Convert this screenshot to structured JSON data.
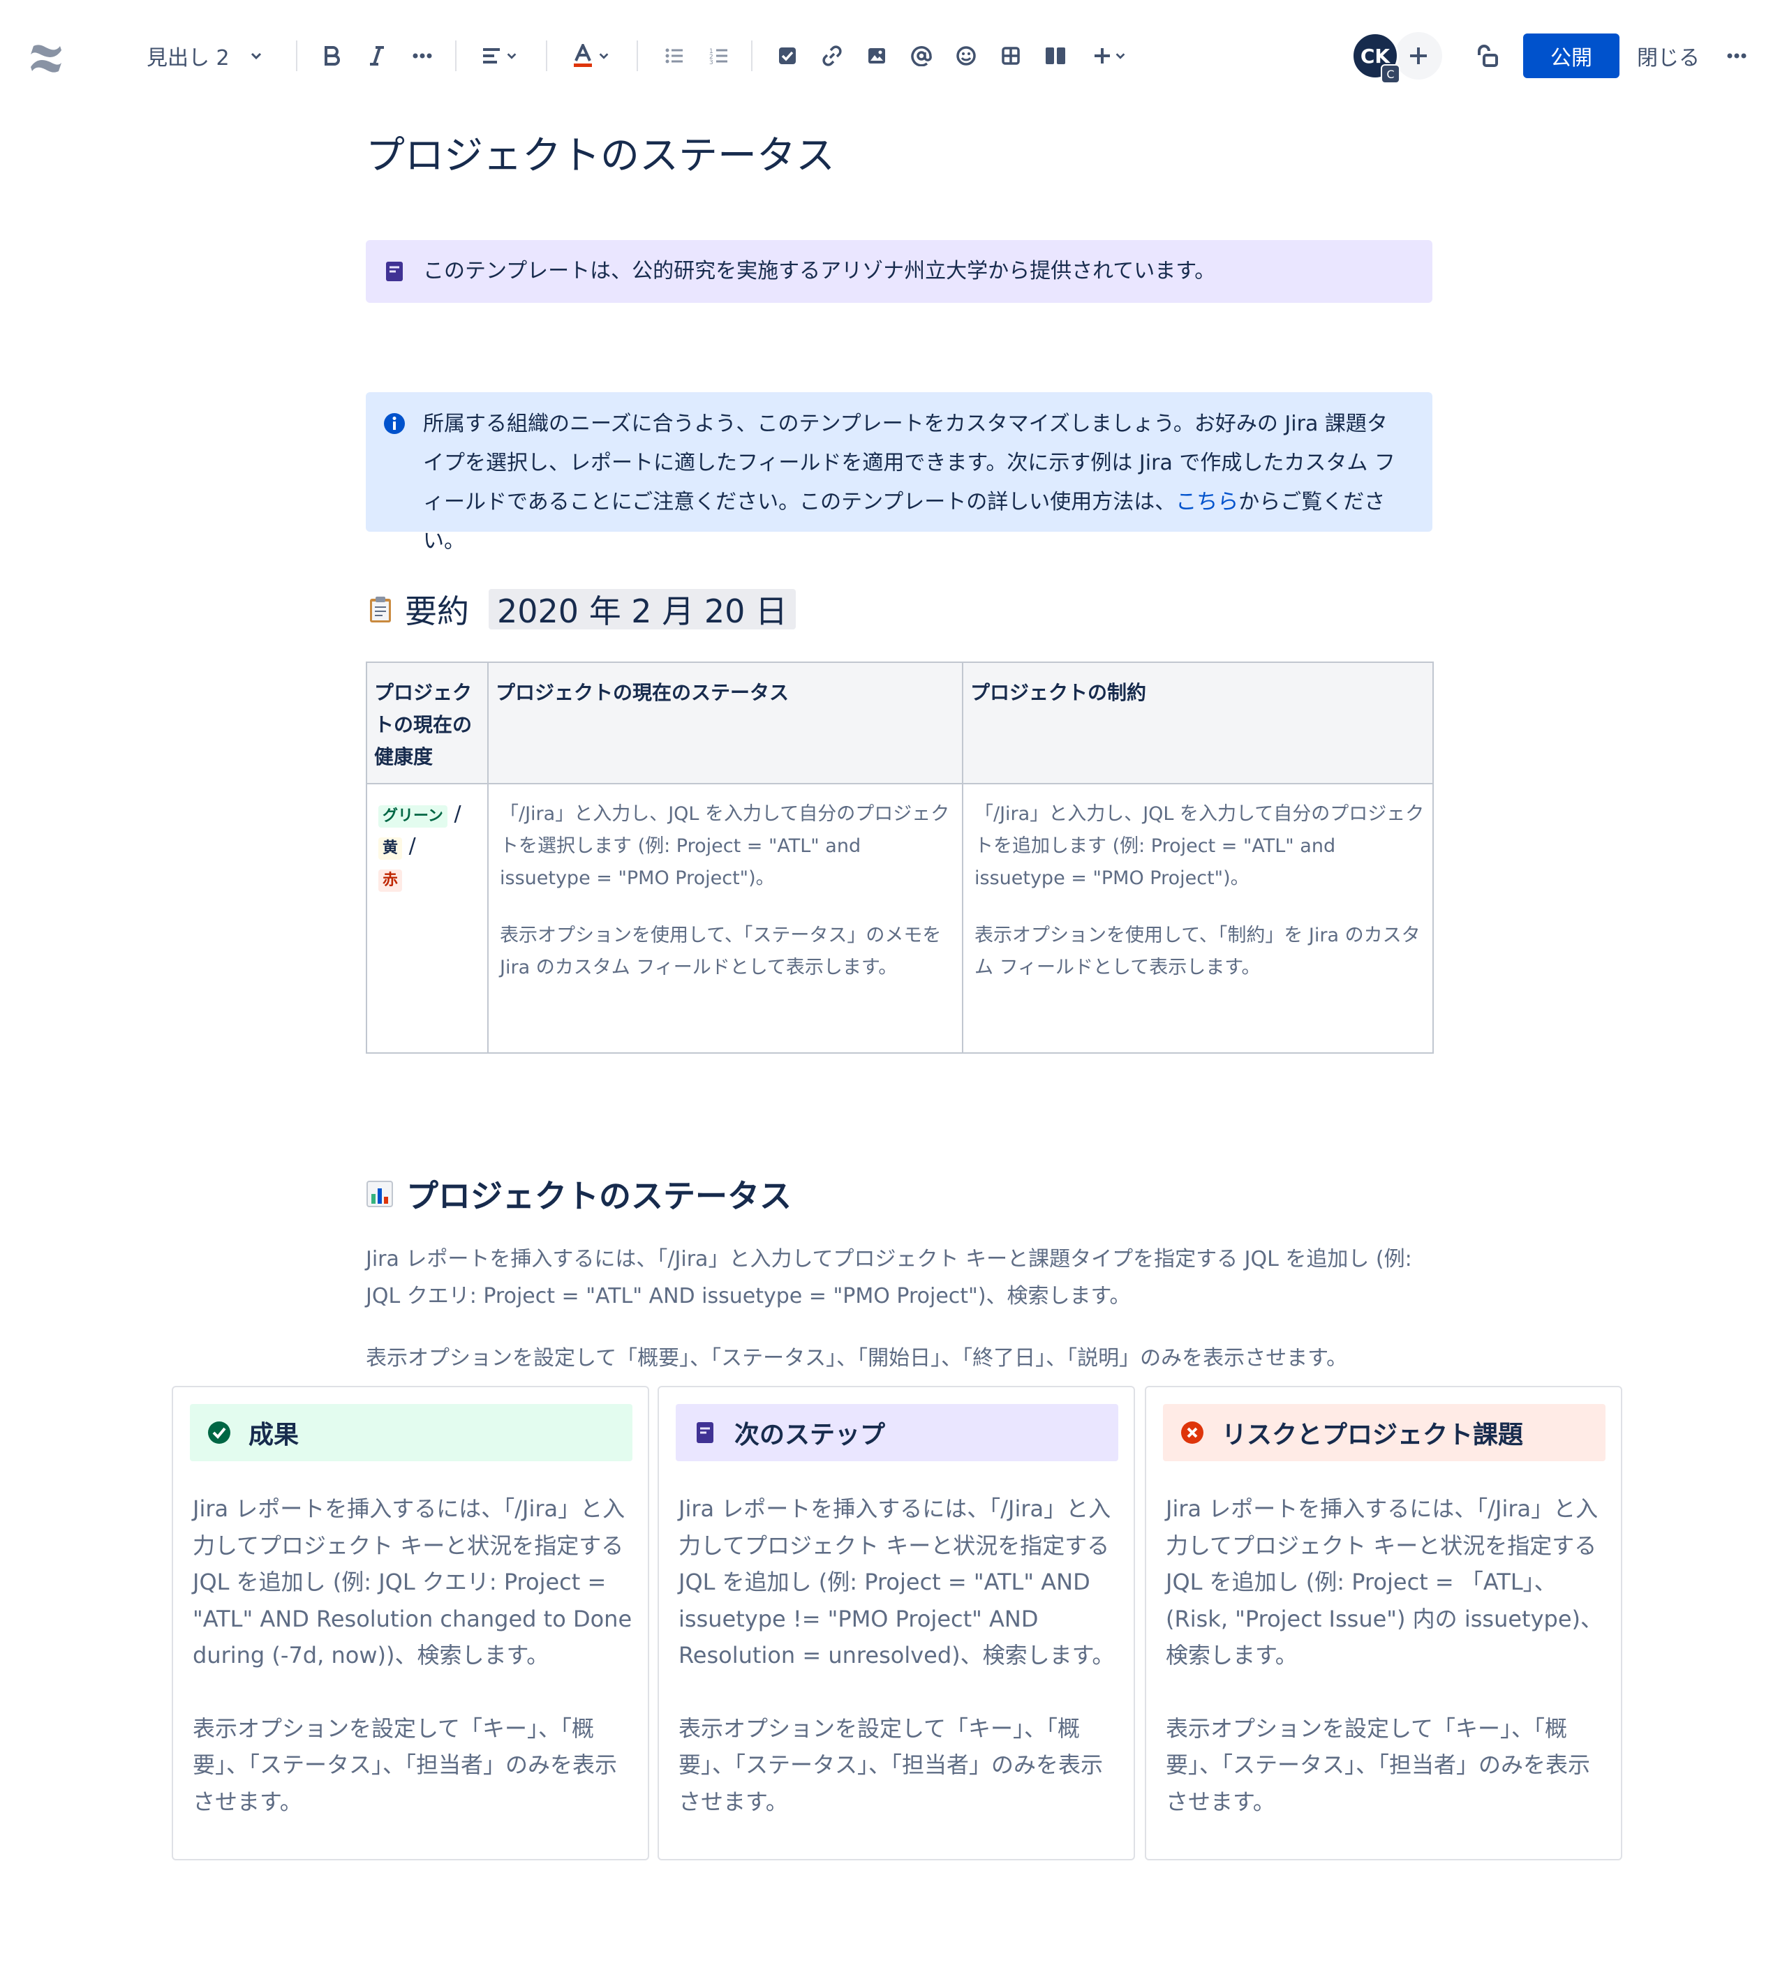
{
  "toolbar": {
    "heading_select": "見出し 2",
    "avatar_initials": "CK",
    "avatar_badge": "C",
    "publish_label": "公開",
    "close_label": "閉じる"
  },
  "page": {
    "title": "プロジェクトのステータス"
  },
  "note_panel": {
    "text": "このテンプレートは、公的研究を実施するアリゾナ州立大学から提供されています。"
  },
  "info_panel": {
    "text_before_link": "所属する組織のニーズに合うよう、このテンプレートをカスタマイズしましょう。お好みの Jira 課題タイプを選択し、レポートに適したフィールドを適用できます。次に示す例は Jira で作成したカスタム フィールドであることにご注意ください。このテンプレートの詳しい使用方法は、",
    "link_text": "こちら",
    "text_after_link": "からご覧ください。"
  },
  "summary": {
    "heading": "要約",
    "date": "2020 年 2 月 20 日",
    "emoji": "clipboard-icon"
  },
  "table": {
    "headers": [
      "プロジェクトの現在の健康度",
      "プロジェクトの現在のステータス",
      "プロジェクトの制約"
    ],
    "health": {
      "green": "グリーン",
      "yellow": "黄",
      "red": "赤",
      "separator": "/"
    },
    "status_col": {
      "para1": "「/Jira」と入力し、JQL を入力して自分のプロジェクトを選択します (例: Project = \"ATL\" and issuetype = \"PMO Project\")。",
      "para2": "表示オプションを使用して、「ステータス」のメモを Jira のカスタム フィールドとして表示します。"
    },
    "constraint_col": {
      "para1": "「/Jira」と入力し、JQL を入力して自分のプロジェクトを追加します (例: Project = \"ATL\" and issuetype = \"PMO Project\")。",
      "para2": "表示オプションを使用して、「制約」を Jira のカスタム フィールドとして表示します。"
    }
  },
  "status_section": {
    "heading": "プロジェクトのステータス",
    "emoji": "bar-chart-icon",
    "body1": "Jira レポートを挿入するには、「/Jira」と入力してプロジェクト キーと課題タイプを指定する JQL を追加し (例: JQL クエリ: Project = \"ATL\" AND issuetype = \"PMO Project\")、検索します。",
    "body2": "表示オプションを設定して「概要」、「ステータス」、「開始日」、「終了日」、「説明」のみを表示させます。"
  },
  "cards": [
    {
      "title": "成果",
      "icon": "check-circle-icon",
      "para1": "Jira レポートを挿入するには、「/Jira」と入力してプロジェクト キーと状況を指定する JQL を追加し (例: JQL クエリ: Project = \"ATL\" AND Resolution changed to Done during (-7d, now))、検索します。",
      "para2": "表示オプションを設定して「キー」、「概要」、「ステータス」、「担当者」のみを表示させます。"
    },
    {
      "title": "次のステップ",
      "icon": "note-icon",
      "para1": "Jira レポートを挿入するには、「/Jira」と入力してプロジェクト キーと状況を指定する JQL を追加し (例: Project = \"ATL\" AND issuetype != \"PMO Project\" AND Resolution = unresolved)、検索します。",
      "para2": "表示オプションを設定して「キー」、「概要」、「ステータス」、「担当者」のみを表示させます。"
    },
    {
      "title": "リスクとプロジェクト課題",
      "icon": "error-circle-icon",
      "para1": "Jira レポートを挿入するには、「/Jira」と入力してプロジェクト キーと状況を指定する JQL を追加し (例: Project = 「ATL」、(Risk, \"Project Issue\") 内の issuetype)、検索します。",
      "para2": "表示オプションを設定して「キー」、「概要」、「ステータス」、「担当者」のみを表示させます。"
    }
  ],
  "colors": {
    "primary": "#0052cc",
    "note_bg": "#eae6ff",
    "info_bg": "#deebff",
    "success_bg": "#e3fcef",
    "error_bg": "#ffebe6"
  }
}
